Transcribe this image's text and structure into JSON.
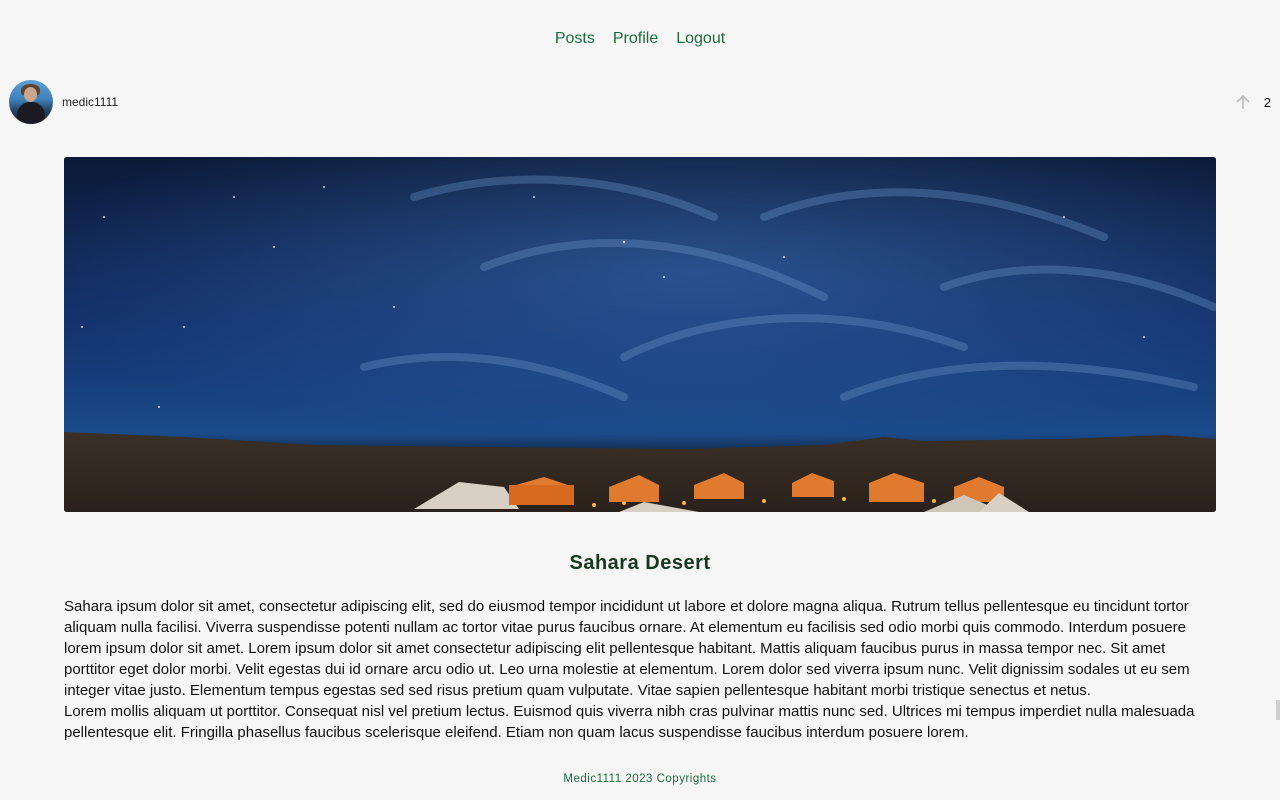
{
  "nav": {
    "posts": "Posts",
    "profile": "Profile",
    "logout": "Logout"
  },
  "author": {
    "username": "medic1111"
  },
  "votes": {
    "count": "2"
  },
  "post": {
    "title": "Sahara Desert",
    "paragraphs": [
      "Sahara ipsum dolor sit amet, consectetur adipiscing elit, sed do eiusmod tempor incididunt ut labore et dolore magna aliqua. Rutrum tellus pellentesque eu tincidunt tortor aliquam nulla facilisi. Viverra suspendisse potenti nullam ac tortor vitae purus faucibus ornare. At elementum eu facilisis sed odio morbi quis commodo. Interdum posuere lorem ipsum dolor sit amet. Lorem ipsum dolor sit amet consectetur adipiscing elit pellentesque habitant. Mattis aliquam faucibus purus in massa tempor nec. Sit amet porttitor eget dolor morbi. Velit egestas dui id ornare arcu odio ut. Leo urna molestie at elementum. Lorem dolor sed viverra ipsum nunc. Velit dignissim sodales ut eu sem integer vitae justo. Elementum tempus egestas sed sed risus pretium quam vulputate. Vitae sapien pellentesque habitant morbi tristique senectus et netus.",
      "Lorem mollis aliquam ut porttitor. Consequat nisl vel pretium lectus. Euismod quis viverra nibh cras pulvinar mattis nunc sed. Ultrices mi tempus imperdiet nulla malesuada pellentesque elit. Fringilla phasellus faucibus scelerisque eleifend. Etiam non quam lacus suspendisse faucibus interdum posuere lorem."
    ]
  },
  "footer": {
    "text": "Medic1111 2023 Copyrights"
  },
  "colors": {
    "accent": "#1f6b3f",
    "title": "#173821",
    "background": "#f6f6f6"
  },
  "icons": {
    "upvote": "arrow-up-icon"
  }
}
